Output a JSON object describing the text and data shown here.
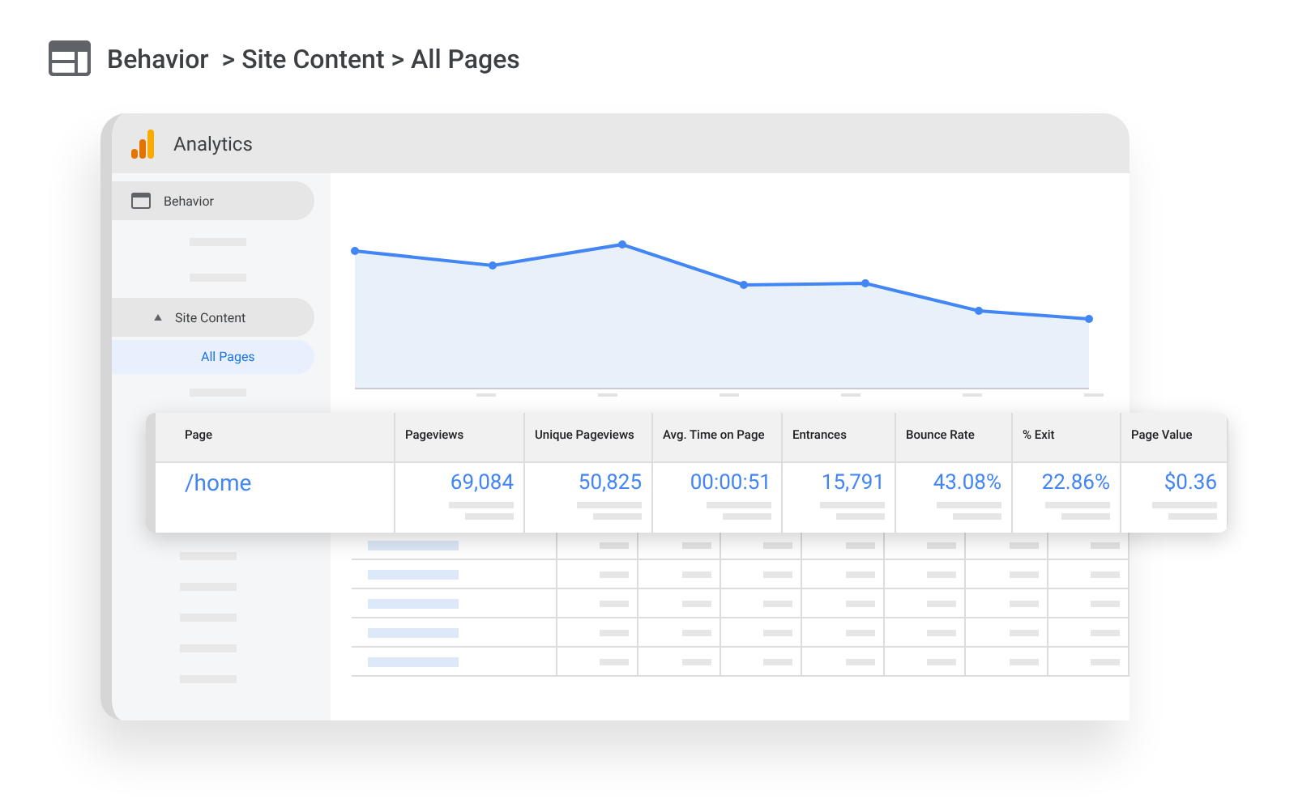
{
  "header": {
    "title": "Behavior  > Site Content > All Pages"
  },
  "app": {
    "title": "Analytics"
  },
  "sidebar": {
    "items": [
      {
        "kind": "section",
        "label": "Behavior",
        "selected": false
      },
      {
        "kind": "placeholder"
      },
      {
        "kind": "placeholder"
      },
      {
        "kind": "section",
        "label": "Site Content",
        "expanded": true,
        "selected": false
      },
      {
        "kind": "child",
        "label": "All Pages",
        "selected": true
      },
      {
        "kind": "placeholder"
      }
    ]
  },
  "table": {
    "columns": [
      "Page",
      "Pageviews",
      "Unique Pageviews",
      "Avg. Time on Page",
      "Entrances",
      "Bounce Rate",
      "% Exit",
      "Page Value"
    ],
    "rows": [
      {
        "cells": [
          "/home",
          "69,084",
          "50,825",
          "00:00:51",
          "15,791",
          "43.08%",
          "22.86%",
          "$0.36"
        ]
      }
    ]
  }
}
